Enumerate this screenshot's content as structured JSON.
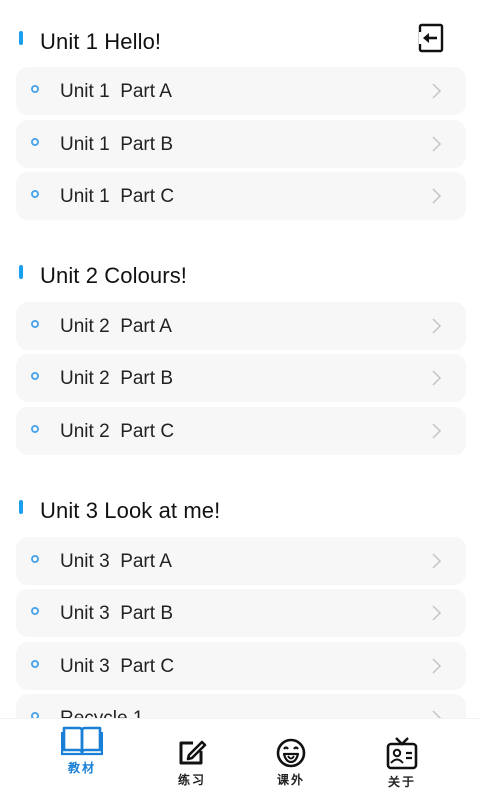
{
  "header": {
    "exit_icon": "exit-door-icon"
  },
  "sections": [
    {
      "title": "Unit 1 Hello!",
      "items": [
        {
          "label": "Unit 1  Part A"
        },
        {
          "label": "Unit 1  Part B"
        },
        {
          "label": "Unit 1  Part C"
        }
      ]
    },
    {
      "title": "Unit 2 Colours!",
      "items": [
        {
          "label": "Unit 2  Part A"
        },
        {
          "label": "Unit 2  Part B"
        },
        {
          "label": "Unit 2  Part C"
        }
      ]
    },
    {
      "title": "Unit 3 Look at me!",
      "items": [
        {
          "label": "Unit 3  Part A"
        },
        {
          "label": "Unit 3  Part B"
        },
        {
          "label": "Unit 3  Part C"
        },
        {
          "label": "Recycle 1"
        }
      ]
    }
  ],
  "tabbar": {
    "tabs": [
      {
        "label": "教材",
        "icon": "book-icon",
        "active": true
      },
      {
        "label": "练习",
        "icon": "edit-icon",
        "active": false
      },
      {
        "label": "课外",
        "icon": "smile-icon",
        "active": false
      },
      {
        "label": "关于",
        "icon": "id-card-icon",
        "active": false
      }
    ]
  },
  "colors": {
    "accent": "#1aa0ee",
    "active_tab": "#1a7fd6",
    "card_bg": "#f7f7f7"
  }
}
